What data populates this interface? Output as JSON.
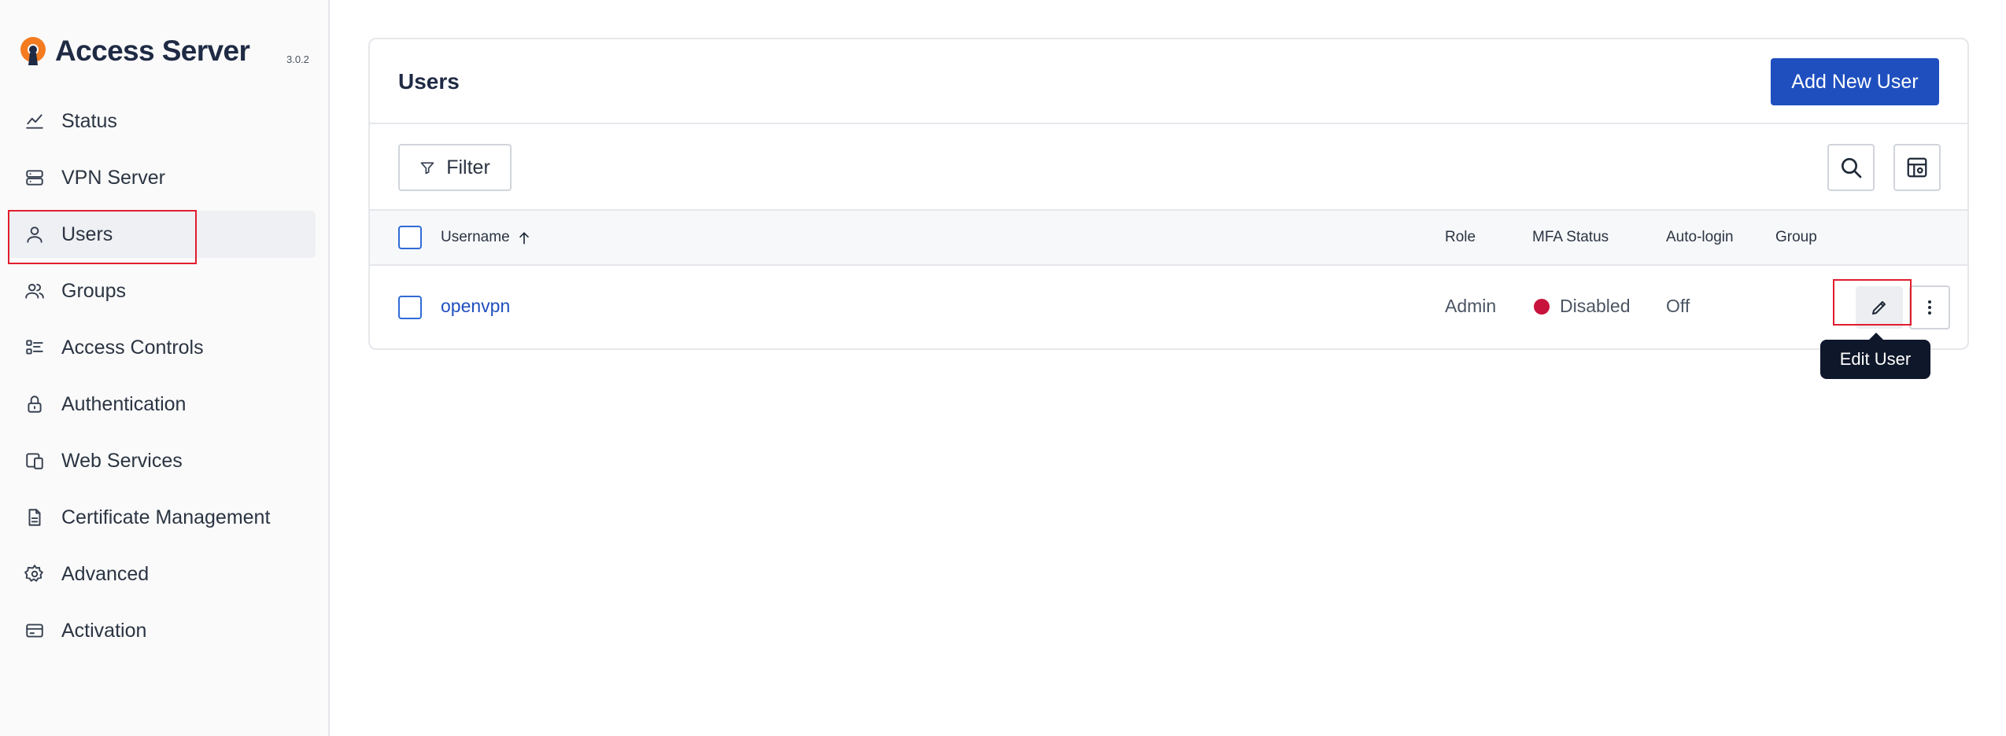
{
  "brand": {
    "name": "Access Server",
    "version": "3.0.2",
    "logo_icon": "openvpn-logo-icon",
    "accent": "#f47b20"
  },
  "sidebar": {
    "items": [
      {
        "label": "Status",
        "icon": "chart-line-icon"
      },
      {
        "label": "VPN Server",
        "icon": "server-icon"
      },
      {
        "label": "Users",
        "icon": "user-icon",
        "active": true
      },
      {
        "label": "Groups",
        "icon": "users-icon"
      },
      {
        "label": "Access Controls",
        "icon": "list-check-icon"
      },
      {
        "label": "Authentication",
        "icon": "lock-icon"
      },
      {
        "label": "Web Services",
        "icon": "devices-icon"
      },
      {
        "label": "Certificate Management",
        "icon": "document-icon"
      },
      {
        "label": "Advanced",
        "icon": "gear-icon"
      },
      {
        "label": "Activation",
        "icon": "card-icon"
      }
    ]
  },
  "main": {
    "title": "Users",
    "add_button": "Add New User",
    "filter_label": "Filter",
    "columns": [
      "Username",
      "Role",
      "MFA Status",
      "Auto-login",
      "Group"
    ],
    "sort": {
      "column": "Username",
      "direction": "asc"
    },
    "rows": [
      {
        "username": "openvpn",
        "role": "Admin",
        "mfa_status": "Disabled",
        "auto_login": "Off",
        "group": ""
      }
    ],
    "tooltip": "Edit User"
  },
  "colors": {
    "primary": "#1f4fbf",
    "highlight": "#e11d2e",
    "status_disabled": "#c8133d"
  }
}
